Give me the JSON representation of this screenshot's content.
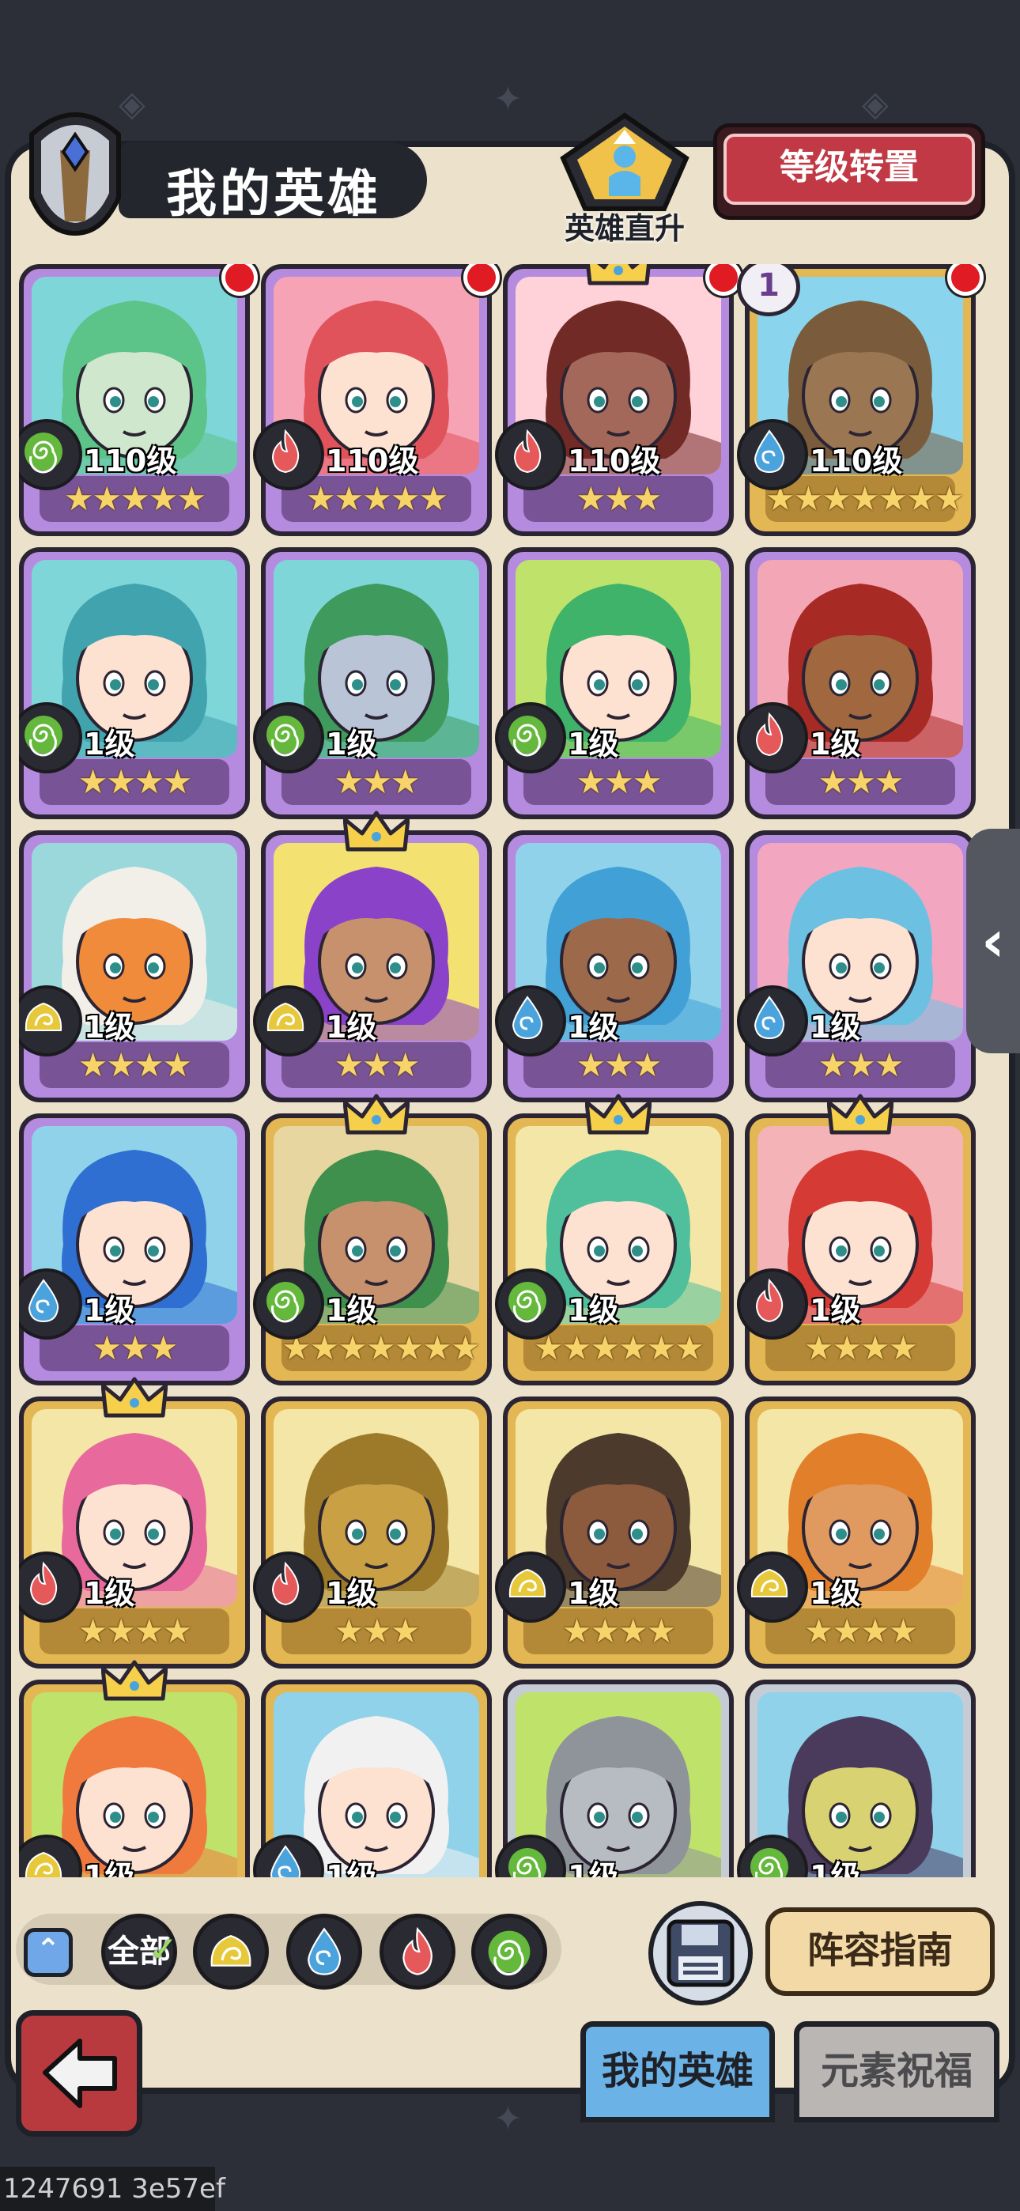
{
  "header": {
    "title": "我的英雄",
    "promote_label": "英雄直升",
    "transfer_button": "等级转置"
  },
  "colors": {
    "fire": "#e5595a",
    "wind": "#64b83c",
    "water": "#4aa3dc",
    "earth": "#e6c83a"
  },
  "heroes": [
    {
      "level": "110级",
      "element": "wind",
      "stars": "★★★★★",
      "frame": "purple",
      "bg": "#7fd6d9",
      "skin": "#cfe7cc",
      "hair": "#5cc389",
      "red_dot": true,
      "crown": false,
      "badge": false
    },
    {
      "level": "110级",
      "element": "fire",
      "stars": "★★★★★",
      "frame": "purple",
      "bg": "#f6a3b5",
      "skin": "#fde1d1",
      "hair": "#e0535a",
      "red_dot": true,
      "crown": false,
      "badge": false
    },
    {
      "level": "110级",
      "element": "fire",
      "stars": "★★★",
      "frame": "purple",
      "bg": "#ffd1d9",
      "skin": "#a4685a",
      "hair": "#722a26",
      "red_dot": true,
      "crown": true,
      "badge": false
    },
    {
      "level": "110级",
      "element": "water",
      "stars": "★★★★★★★",
      "frame": "gold",
      "bg": "#8bd4ee",
      "skin": "#9b7652",
      "hair": "#7a5c3c",
      "red_dot": true,
      "crown": false,
      "badge": true,
      "badge_text": "1"
    },
    {
      "level": "1级",
      "element": "wind",
      "stars": "★★★★",
      "frame": "purple",
      "bg": "#7fd6d9",
      "skin": "#fde1d1",
      "hair": "#41a3ae",
      "red_dot": false,
      "crown": false,
      "badge": false
    },
    {
      "level": "1级",
      "element": "wind",
      "stars": "★★★",
      "frame": "purple",
      "bg": "#7fd6d9",
      "skin": "#b9c4d6",
      "hair": "#3f9a5d",
      "red_dot": false,
      "crown": false,
      "badge": false
    },
    {
      "level": "1级",
      "element": "wind",
      "stars": "★★★",
      "frame": "purple",
      "bg": "#bfe36a",
      "skin": "#fde1d1",
      "hair": "#3fb36a",
      "red_dot": false,
      "crown": false,
      "badge": false
    },
    {
      "level": "1级",
      "element": "fire",
      "stars": "★★★",
      "frame": "purple",
      "bg": "#f3a6b5",
      "skin": "#a1683f",
      "hair": "#a82a25",
      "red_dot": false,
      "crown": false,
      "badge": false
    },
    {
      "level": "1级",
      "element": "earth",
      "stars": "★★★★",
      "frame": "purple",
      "bg": "#9ad8dc",
      "skin": "#ef8b3a",
      "hair": "#f2efe9",
      "red_dot": false,
      "crown": false,
      "badge": false
    },
    {
      "level": "1级",
      "element": "earth",
      "stars": "★★★",
      "frame": "purple",
      "bg": "#f3e271",
      "skin": "#c8916d",
      "hair": "#8a42c9",
      "red_dot": false,
      "crown": true,
      "badge": false
    },
    {
      "level": "1级",
      "element": "water",
      "stars": "★★★",
      "frame": "purple",
      "bg": "#8fd2ea",
      "skin": "#9c6a4a",
      "hair": "#41a0d6",
      "red_dot": false,
      "crown": false,
      "badge": false
    },
    {
      "level": "1级",
      "element": "water",
      "stars": "★★★",
      "frame": "purple",
      "bg": "#f3a6c0",
      "skin": "#fde1d1",
      "hair": "#6cc1e3",
      "red_dot": false,
      "crown": false,
      "badge": false
    },
    {
      "level": "1级",
      "element": "water",
      "stars": "★★★",
      "frame": "purple",
      "bg": "#8fd2ea",
      "skin": "#fde1d1",
      "hair": "#2f6fd1",
      "red_dot": false,
      "crown": false,
      "badge": false
    },
    {
      "level": "1级",
      "element": "wind",
      "stars": "★★★★★★★",
      "frame": "gold",
      "bg": "#e7d6a0",
      "skin": "#c8916d",
      "hair": "#3f8f4d",
      "red_dot": false,
      "crown": true,
      "badge": false
    },
    {
      "level": "1级",
      "element": "wind",
      "stars": "★★★★★★",
      "frame": "gold",
      "bg": "#f3e6a6",
      "skin": "#fde1d1",
      "hair": "#4fbf9c",
      "red_dot": false,
      "crown": true,
      "badge": false
    },
    {
      "level": "1级",
      "element": "fire",
      "stars": "★★★★",
      "frame": "gold",
      "bg": "#f3b3b7",
      "skin": "#fde1d1",
      "hair": "#d53b34",
      "red_dot": false,
      "crown": true,
      "badge": false
    },
    {
      "level": "1级",
      "element": "fire",
      "stars": "★★★★",
      "frame": "gold",
      "bg": "#f3e6a6",
      "skin": "#fde1d1",
      "hair": "#e86a9c",
      "red_dot": false,
      "crown": true,
      "badge": false
    },
    {
      "level": "1级",
      "element": "fire",
      "stars": "★★★",
      "frame": "gold",
      "bg": "#f3e6a6",
      "skin": "#c9a043",
      "hair": "#9c7a29",
      "red_dot": false,
      "crown": false,
      "badge": false
    },
    {
      "level": "1级",
      "element": "earth",
      "stars": "★★★★",
      "frame": "gold",
      "bg": "#f3e6a6",
      "skin": "#8c5a3c",
      "hair": "#4c3a2c",
      "red_dot": false,
      "crown": false,
      "badge": false
    },
    {
      "level": "1级",
      "element": "earth",
      "stars": "★★★★",
      "frame": "gold",
      "bg": "#f3e6a6",
      "skin": "#e09a5f",
      "hair": "#e27f2a",
      "red_dot": false,
      "crown": false,
      "badge": false
    },
    {
      "level": "1级",
      "element": "earth",
      "stars": "★★★",
      "frame": "gold",
      "bg": "#bfe36a",
      "skin": "#fde1d1",
      "hair": "#f07a3e",
      "red_dot": false,
      "crown": true,
      "badge": false
    },
    {
      "level": "1级",
      "element": "water",
      "stars": "★★★",
      "frame": "gold",
      "bg": "#8fd2ea",
      "skin": "#fde1d1",
      "hair": "#f1f1f1",
      "red_dot": false,
      "crown": false,
      "badge": false
    },
    {
      "level": "1级",
      "element": "wind",
      "stars": "★★★",
      "frame": "silver",
      "bg": "#bfe36a",
      "skin": "#b7bcc2",
      "hair": "#8f949b",
      "red_dot": false,
      "crown": false,
      "badge": false
    },
    {
      "level": "1级",
      "element": "wind",
      "stars": "★★★",
      "frame": "silver",
      "bg": "#8fd2ea",
      "skin": "#d8d273",
      "hair": "#4a3a5c",
      "red_dot": false,
      "crown": false,
      "badge": false
    }
  ],
  "filters": {
    "all_label": "全部",
    "items": [
      "earth",
      "water",
      "fire",
      "wind"
    ]
  },
  "bottom": {
    "lineup_button": "阵容指南",
    "tab_my_heroes": "我的英雄",
    "tab_element_blessing": "元素祝福"
  },
  "side_handle": "‹",
  "corner_text": "1247691 3e57ef"
}
